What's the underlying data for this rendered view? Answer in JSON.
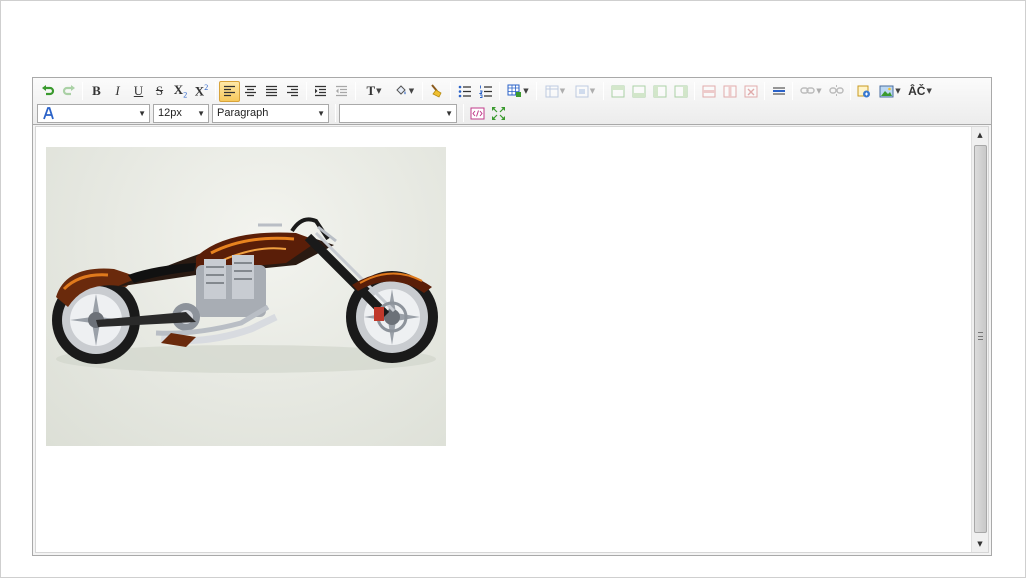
{
  "toolbar": {
    "font_name_value": "",
    "font_size_value": "12px",
    "format_value": "Paragraph",
    "style_value": "",
    "labels": {
      "bold": "B",
      "italic": "I",
      "underline": "U",
      "strike": "S",
      "subscript": "X",
      "superscript": "X",
      "font_color": "T",
      "spellcheck": "ÂČ"
    }
  },
  "content": {
    "image_subject": "motorcycle-photo"
  },
  "colors": {
    "accent_active": "#f7c95c",
    "border": "#a9a9a9",
    "undo_green": "#3a9a2e"
  }
}
